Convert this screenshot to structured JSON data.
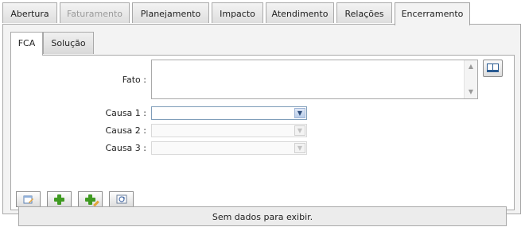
{
  "tabs": [
    {
      "label": "Abertura",
      "state": "normal"
    },
    {
      "label": "Faturamento",
      "state": "disabled"
    },
    {
      "label": "Planejamento",
      "state": "normal"
    },
    {
      "label": "Impacto",
      "state": "normal"
    },
    {
      "label": "Atendimento",
      "state": "normal"
    },
    {
      "label": "Relações",
      "state": "normal"
    },
    {
      "label": "Encerramento",
      "state": "active"
    }
  ],
  "subtabs": [
    {
      "label": "FCA",
      "state": "active"
    },
    {
      "label": "Solução",
      "state": "normal"
    }
  ],
  "form": {
    "fato_label": "Fato :",
    "fato_value": "",
    "causa1_label": "Causa 1 :",
    "causa1_value": "",
    "causa2_label": "Causa 2 :",
    "causa2_value": "",
    "causa3_label": "Causa 3 :",
    "causa3_value": ""
  },
  "toolbar": {
    "buttons": [
      "edit-icon",
      "add-icon",
      "add-edit-icon",
      "refresh-icon"
    ]
  },
  "grid": {
    "empty_message": "Sem dados para exibir."
  }
}
